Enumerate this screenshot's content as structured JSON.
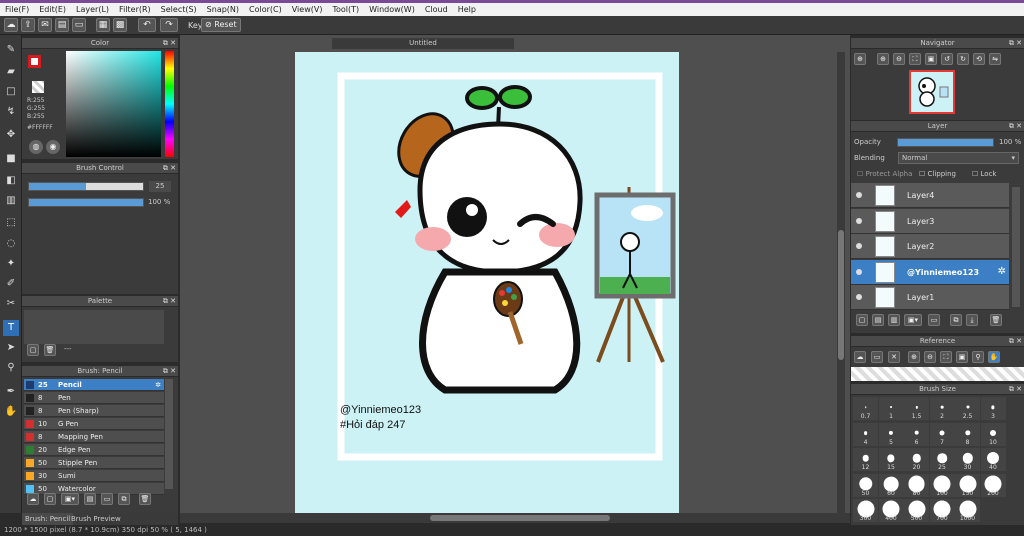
{
  "menu": [
    "File(F)",
    "Edit(E)",
    "Layer(L)",
    "Filter(R)",
    "Select(S)",
    "Snap(N)",
    "Color(C)",
    "View(V)",
    "Tool(T)",
    "Window(W)",
    "Cloud",
    "Help"
  ],
  "toolbar": {
    "key_label": "Key",
    "reset_label": "Reset"
  },
  "panels": {
    "color": "Color",
    "brush_control": "Brush Control",
    "palette": "Palette",
    "brush": "Brush: Pencil",
    "navigator": "Navigator",
    "layer": "Layer",
    "reference": "Reference",
    "brush_size": "Brush Size"
  },
  "color": {
    "r": "R:255",
    "g": "G:255",
    "b": "B:255",
    "hex": "#FFFFFF",
    "fg": "#d31b22"
  },
  "brush_control": {
    "size": "25",
    "opacity": "100 %",
    "size_fraction": 0.5,
    "opacity_fraction": 1.0
  },
  "palette": {
    "label": "---"
  },
  "brushes": [
    {
      "size": "25",
      "name": "Pencil",
      "color": "#1e3b6e",
      "selected": true
    },
    {
      "size": "8",
      "name": "Pen",
      "color": "#222222"
    },
    {
      "size": "8",
      "name": "Pen (Sharp)",
      "color": "#222222"
    },
    {
      "size": "10",
      "name": "G Pen",
      "color": "#d32f2f"
    },
    {
      "size": "8",
      "name": "Mapping Pen",
      "color": "#d32f2f"
    },
    {
      "size": "20",
      "name": "Edge Pen",
      "color": "#2e7d32"
    },
    {
      "size": "50",
      "name": "Stipple Pen",
      "color": "#f9a825"
    },
    {
      "size": "30",
      "name": "Sumi",
      "color": "#f9a825"
    },
    {
      "size": "50",
      "name": "Watercolor",
      "color": "#4fc3f7"
    }
  ],
  "bottom_tabs": [
    "Brush: Pencil",
    "Brush Preview"
  ],
  "document": {
    "title": "Untitled",
    "status": "1200 * 1500 pixel   (8.7 * 10.9cm)   350 dpi   50 %   ( 5, 1464 )"
  },
  "artwork": {
    "line1": "@Yinniemeo123",
    "line2": "#Hỏi đáp 247"
  },
  "layer": {
    "opacity_label": "Opacity",
    "opacity_value": "100 %",
    "opacity_fraction": 1.0,
    "blending_label": "Blending",
    "blending_value": "Normal",
    "protect_alpha": "Protect Alpha",
    "clipping": "Clipping",
    "lock": "Lock",
    "layers": [
      {
        "name": "Layer4",
        "selected": false
      },
      {
        "name": "Layer3",
        "selected": false
      },
      {
        "name": "Layer2",
        "selected": false
      },
      {
        "name": "@Yinniemeo123",
        "selected": true
      },
      {
        "name": "Layer1",
        "selected": false
      }
    ]
  },
  "brush_sizes": [
    "0.7",
    "1",
    "1.5",
    "2",
    "2.5",
    "3",
    "4",
    "5",
    "6",
    "7",
    "8",
    "10",
    "12",
    "15",
    "20",
    "25",
    "30",
    "40",
    "50",
    "60",
    "80",
    "100",
    "150",
    "200",
    "300",
    "400",
    "500",
    "700",
    "1000"
  ]
}
